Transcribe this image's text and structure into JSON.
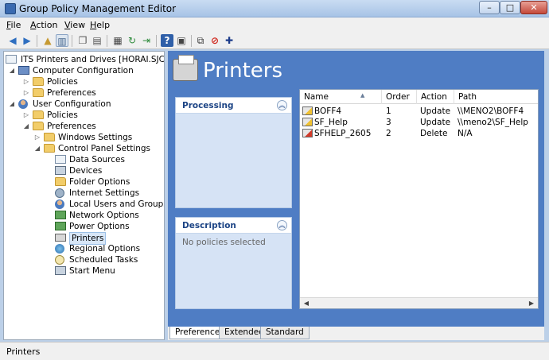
{
  "window": {
    "title": "Group Policy Management Editor",
    "controls": {
      "minimize": "–",
      "maximize": "□",
      "close": "✕"
    }
  },
  "menu": {
    "items": [
      {
        "label": "File",
        "accel": "F",
        "rest": "ile"
      },
      {
        "label": "Action",
        "accel": "A",
        "rest": "ction"
      },
      {
        "label": "View",
        "accel": "V",
        "rest": "iew"
      },
      {
        "label": "Help",
        "accel": "H",
        "rest": "elp"
      }
    ]
  },
  "toolbar": {
    "back": "◀",
    "forward": "▶",
    "up": "▲",
    "show_hide": "▥",
    "copy": "❐",
    "paste": "▤",
    "properties": "▦",
    "refresh": "↻",
    "export": "⇥",
    "help": "?",
    "console": "▣",
    "filter": "⧉",
    "stop": "⊘",
    "add": "✚"
  },
  "tree": {
    "root": "ITS Printers and Drives [HORAI.SJCSF.SJCA...",
    "computer_config": "Computer Configuration",
    "cc_policies": "Policies",
    "cc_preferences": "Preferences",
    "user_config": "User Configuration",
    "uc_policies": "Policies",
    "uc_preferences": "Preferences",
    "windows_settings": "Windows Settings",
    "control_panel": "Control Panel Settings",
    "data_sources": "Data Sources",
    "devices": "Devices",
    "folder_options": "Folder Options",
    "internet_settings": "Internet Settings",
    "local_users": "Local Users and Groups",
    "network_options": "Network Options",
    "power_options": "Power Options",
    "printers": "Printers",
    "regional_options": "Regional Options",
    "scheduled_tasks": "Scheduled Tasks",
    "start_menu": "Start Menu"
  },
  "right": {
    "title": "Printers",
    "processing": {
      "title": "Processing",
      "toggle": "︽"
    },
    "description": {
      "title": "Description",
      "toggle": "︽",
      "text": "No policies selected"
    },
    "columns": {
      "name": "Name",
      "order": "Order",
      "action": "Action",
      "path": "Path",
      "sort_glyph": "▲"
    },
    "rows": [
      {
        "name": "BOFF4",
        "order": "1",
        "action": "Update",
        "path": "\\\\MENO2\\BOFF4",
        "kind": "update"
      },
      {
        "name": "SF_Help",
        "order": "3",
        "action": "Update",
        "path": "\\\\meno2\\SF_Help",
        "kind": "update"
      },
      {
        "name": "SFHELP_2605",
        "order": "2",
        "action": "Delete",
        "path": "N/A",
        "kind": "delete"
      }
    ],
    "scroll": {
      "left": "◀",
      "right": "▶"
    }
  },
  "tabs": {
    "preferences": "Preferences",
    "extended": "Extended",
    "standard": "Standard"
  },
  "status": {
    "text": "Printers"
  }
}
